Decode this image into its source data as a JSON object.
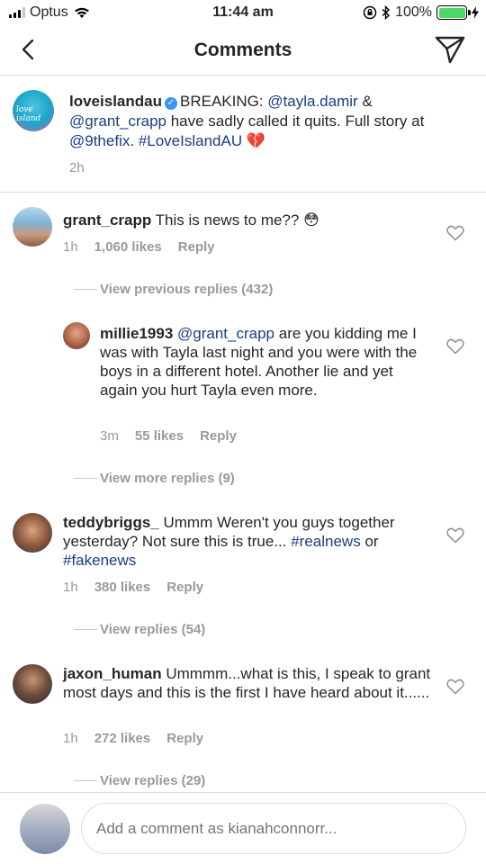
{
  "status_bar": {
    "carrier": "Optus",
    "time": "11:44 am",
    "battery_percent": "100%",
    "battery_level": 1.0,
    "battery_color": "#4cd964"
  },
  "nav": {
    "title": "Comments",
    "back_icon": "chevron-left-icon",
    "send_icon": "paper-plane-icon"
  },
  "caption": {
    "username": "loveislandau",
    "avatar_logo": "love island",
    "parts": {
      "p1": "BREAKING: ",
      "m1": "@tayla.damir",
      "p2": " & ",
      "m2": "@grant_crapp",
      "p3": " have sadly called it quits. Full story at ",
      "m3": "@9thefix",
      "p4": ". ",
      "h1": "#LoveIslandAU",
      "emoji": "💔"
    },
    "time": "2h"
  },
  "comments": [
    {
      "username": "grant_crapp",
      "text": "This is news to me?? 😳",
      "time": "1h",
      "likes": "1,060 likes",
      "reply": "Reply"
    },
    {
      "username": "millie1993",
      "mention": "@grant_crapp",
      "text": " are you kidding me I was with Tayla last night and you were with the boys in a different hotel. Another lie and yet again you hurt Tayla even more.",
      "time": "3m",
      "likes": "55 likes",
      "reply": "Reply"
    },
    {
      "username": "teddybriggs_",
      "text": "Ummm Weren't you guys together yesterday? Not sure this is true... ",
      "tag1": "#realnews",
      "or": " or ",
      "tag2": "#fakenews",
      "time": "1h",
      "likes": "380 likes",
      "reply": "Reply"
    },
    {
      "username": "jaxon_human",
      "text": "Ummmm...what is this, I speak to grant most days and this is the first I have heard about it......",
      "time": "1h",
      "likes": "272 likes",
      "reply": "Reply"
    }
  ],
  "view_links": {
    "previous": "View previous replies (432)",
    "more": "View more replies (9)",
    "teddy": "View replies (54)",
    "jaxon": "View replies (29)"
  },
  "composer": {
    "placeholder": "Add a comment as kianahconnorr..."
  },
  "colors": {
    "link": "#1a3d85",
    "muted": "#999999",
    "divider": "#dbdbdb",
    "verified": "#3897f0"
  }
}
